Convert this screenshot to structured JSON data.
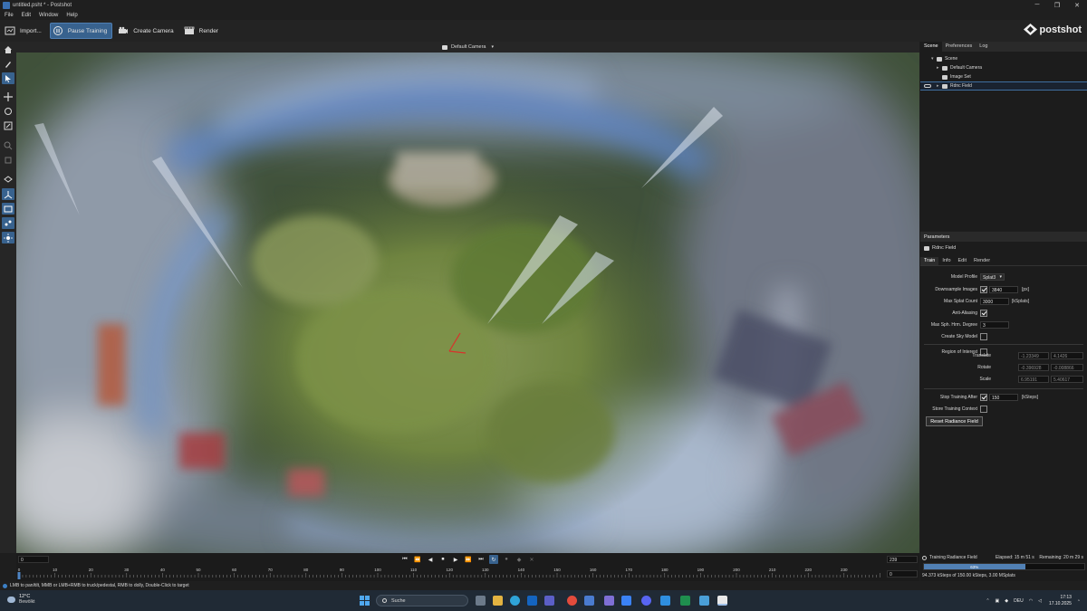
{
  "window": {
    "title": "untitled.psht * - Postshot",
    "controls": [
      "─",
      "❐",
      "✕"
    ]
  },
  "menubar": [
    "File",
    "Edit",
    "Window",
    "Help"
  ],
  "toolbar": {
    "import_label": "Import...",
    "pause_label": "Pause Training",
    "camera_label": "Create Camera",
    "render_label": "Render",
    "logo_text": "postshot",
    "accent_color": "#38628e"
  },
  "viewport": {
    "camera_label": "Default Camera",
    "chevron": "▾"
  },
  "scene_panel": {
    "tabs": [
      "Scene",
      "Preferences",
      "Log"
    ],
    "tree": [
      {
        "label": "Scene",
        "twisty": "▾"
      },
      {
        "label": "Default Camera",
        "twisty": "▸"
      },
      {
        "label": "Image Set",
        "twisty": ""
      },
      {
        "label": "Rdnc Field",
        "twisty": "▸"
      }
    ]
  },
  "params": {
    "header": "Parameters",
    "node_label": "Rdnc Field",
    "tabs": [
      "Train",
      "Info",
      "Edit",
      "Render"
    ],
    "model_profile_label": "Model Profile",
    "model_profile_value": "Splat3",
    "downsample_label": "Downsample Images",
    "downsample_value": "3840",
    "downsample_unit": "[px]",
    "max_splat_label": "Max Splat Count",
    "max_splat_value": "3000",
    "max_splat_unit": "[kSplats]",
    "anti_alias_label": "Anti-Aliasing",
    "max_sph_label": "Max Sph. Hrm. Degree",
    "max_sph_value": "3",
    "sky_label": "Create Sky Model",
    "roi_label": "Region of Interest",
    "translate_label": "Translate",
    "translate_values": [
      "-1.23349",
      "4.1426"
    ],
    "rotate_label": "Rotate",
    "rotate_values": [
      "-0.396928",
      "-0.008866"
    ],
    "scale_label": "Scale",
    "scale_values": [
      "6.95191",
      "5.40617"
    ],
    "stop_after_label": "Stop Training After",
    "stop_after_value": "150",
    "stop_after_unit": "[kSteps]",
    "store_ctx_label": "Store Training Context",
    "reset_label": "Reset Radiance Field"
  },
  "timeline": {
    "start": "0",
    "end": "239",
    "frame": "0",
    "buttons": [
      "⏮",
      "⏪",
      "◀",
      "⏹",
      "▶",
      "⏩",
      "⏭"
    ],
    "ticks": [
      "0",
      "10",
      "20",
      "30",
      "40",
      "50",
      "60",
      "70",
      "80",
      "90",
      "100",
      "110",
      "120",
      "130",
      "140",
      "150",
      "160",
      "170",
      "180",
      "190",
      "200",
      "210",
      "220",
      "230"
    ]
  },
  "training": {
    "title": "Training Radiance Field",
    "elapsed": "Elapsed: 15 m 51 s",
    "remaining": "Remaining: 20 m 29 s",
    "progress_text": "63%",
    "progress": 0.63,
    "stats": "94.373 kSteps of 150.00 kSteps, 3.00 MSplats"
  },
  "statusbar": {
    "hint": "LMB to pan/tilt, MMB or LMB+RMB to truck/pedestal, RMB to dolly, Double-Click to target"
  },
  "taskbar": {
    "temp": "12°C",
    "weather": "Bewölkt",
    "search_placeholder": "Suche",
    "lang": "DEU",
    "time": "17:13",
    "date": "17.10.2025"
  }
}
